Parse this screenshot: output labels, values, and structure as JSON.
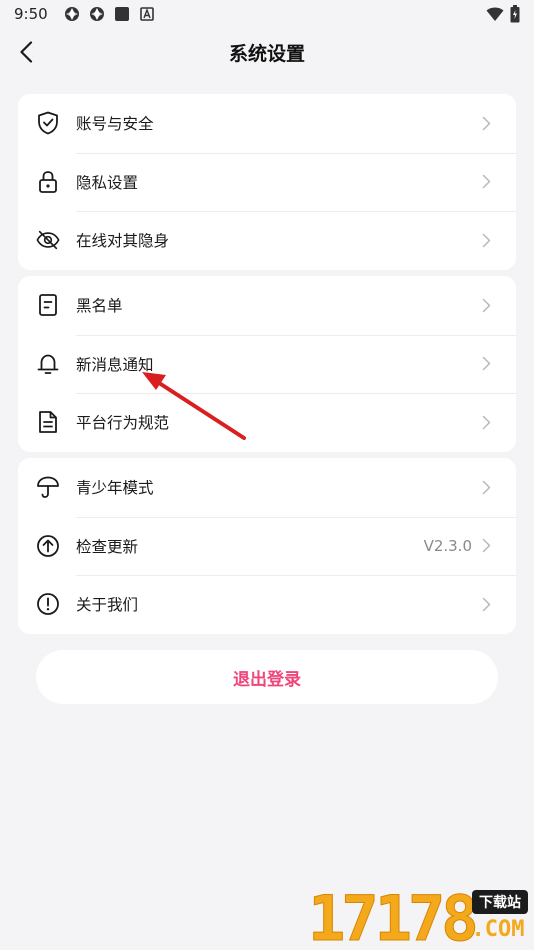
{
  "status_bar": {
    "time": "9:50",
    "icons": [
      "app-notification-icon",
      "app-notification-icon",
      "square-icon",
      "a-icon"
    ],
    "right_icons": [
      "wifi-icon",
      "battery-icon"
    ]
  },
  "header": {
    "title": "系统设置",
    "back_icon": "back-arrow-icon"
  },
  "groups": [
    {
      "items": [
        {
          "label": "账号与安全",
          "icon": "shield-check-icon"
        },
        {
          "label": "隐私设置",
          "icon": "lock-icon"
        },
        {
          "label": "在线对其隐身",
          "icon": "eye-off-icon"
        }
      ]
    },
    {
      "items": [
        {
          "label": "黑名单",
          "icon": "blacklist-icon"
        },
        {
          "label": "新消息通知",
          "icon": "bell-icon"
        },
        {
          "label": "平台行为规范",
          "icon": "document-icon"
        }
      ]
    },
    {
      "items": [
        {
          "label": "青少年模式",
          "icon": "umbrella-icon"
        },
        {
          "label": "检查更新",
          "icon": "arrow-up-circle-icon",
          "value": "V2.3.0"
        },
        {
          "label": "关于我们",
          "icon": "info-circle-icon"
        }
      ]
    }
  ],
  "logout": {
    "label": "退出登录"
  },
  "colors": {
    "background": "#f4f4f6",
    "card": "#ffffff",
    "logout_text": "#f1467a",
    "annotation_arrow": "#d91f1f",
    "watermark": "#f4a81c"
  },
  "watermark": {
    "digits": "17178",
    "badge": "下载站",
    "domain": ".COM"
  }
}
